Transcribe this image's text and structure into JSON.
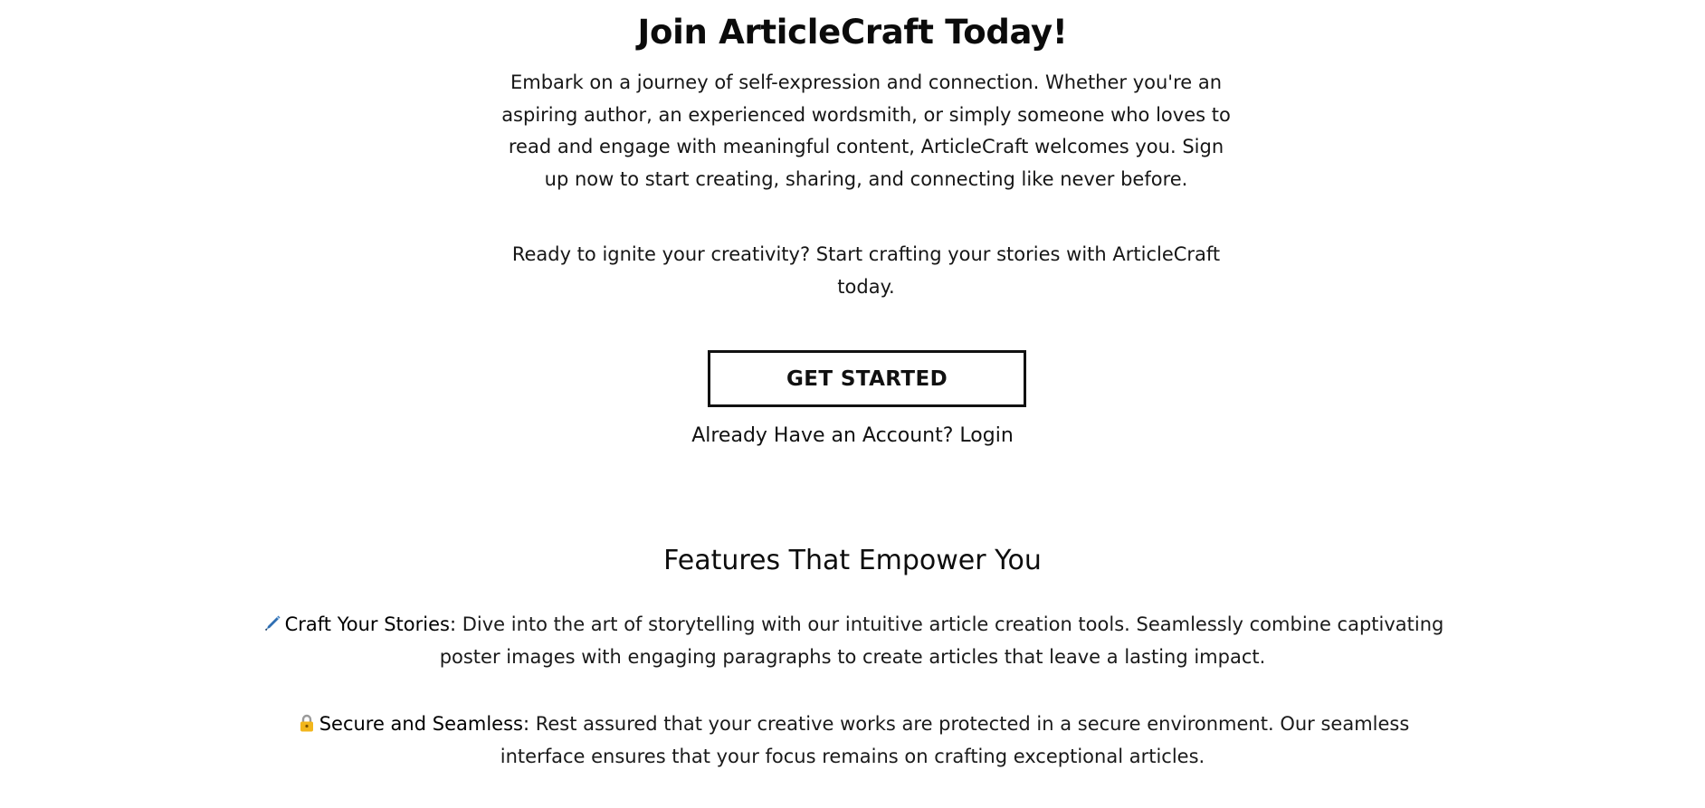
{
  "hero": {
    "title": "Join ArticleCraft Today!",
    "lead": "Embark on a journey of self-expression and connection. Whether you're an aspiring author, an experienced wordsmith, or simply someone who loves to read and engage with meaningful content, ArticleCraft welcomes you. Sign up now to start creating, sharing, and connecting like never before.",
    "cta_text": "Ready to ignite your creativity? Start crafting your stories with ArticleCraft today.",
    "get_started_label": "GET STARTED",
    "account_prompt": "Already Have an Account?",
    "login_label": "Login"
  },
  "features": {
    "title": "Features That Empower You",
    "items": [
      {
        "icon": "pen-icon",
        "heading": "Craft Your Stories:",
        "text": "Dive into the art of storytelling with our intuitive article creation tools. Seamlessly combine captivating poster images with engaging paragraphs to create articles that leave a lasting impact."
      },
      {
        "icon": "lock-icon",
        "heading": "Secure and Seamless:",
        "text": "Rest assured that your creative works are protected in a secure environment. Our seamless interface ensures that your focus remains on crafting exceptional articles."
      }
    ]
  },
  "colors": {
    "text": "#111111",
    "button_border": "#111111",
    "pen_icon": "#2f6fb3",
    "lock_icon": "#f2b61c"
  }
}
